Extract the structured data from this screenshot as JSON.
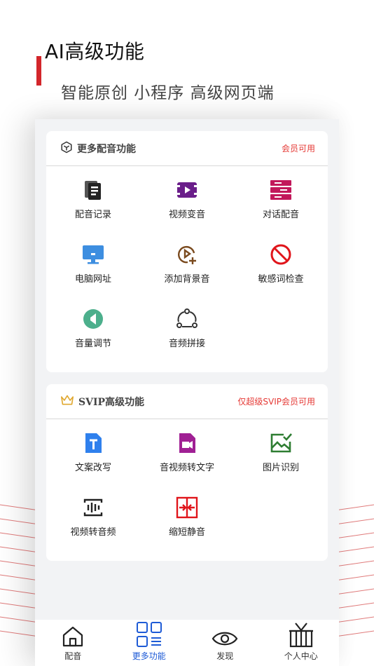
{
  "promo": {
    "title": "AI高级功能",
    "subtitle": "智能原创 小程序  高级网页端"
  },
  "card_more": {
    "title": "更多配音功能",
    "tag": "会员可用",
    "items": [
      {
        "label": "配音记录",
        "icon": "record-icon"
      },
      {
        "label": "视频变音",
        "icon": "video-voice-icon"
      },
      {
        "label": "对话配音",
        "icon": "dialogue-icon"
      },
      {
        "label": "电脑网址",
        "icon": "computer-icon"
      },
      {
        "label": "添加背景音",
        "icon": "add-bgm-icon"
      },
      {
        "label": "敏感词检查",
        "icon": "forbidden-icon"
      },
      {
        "label": "音量调节",
        "icon": "volume-icon"
      },
      {
        "label": "音频拼接",
        "icon": "splice-icon"
      }
    ]
  },
  "card_svip": {
    "title": "SVIP高级功能",
    "tag": "仅超级SVIP会员可用",
    "items": [
      {
        "label": "文案改写",
        "icon": "text-icon"
      },
      {
        "label": "音视频转文字",
        "icon": "video-to-text-icon"
      },
      {
        "label": "图片识别",
        "icon": "image-icon"
      },
      {
        "label": "视频转音频",
        "icon": "audio-wave-icon"
      },
      {
        "label": "缩短静音",
        "icon": "shorten-icon"
      }
    ]
  },
  "tabbar": {
    "items": [
      {
        "label": "配音"
      },
      {
        "label": "更多功能"
      },
      {
        "label": "发现"
      },
      {
        "label": "个人中心"
      }
    ]
  },
  "colors": {
    "accent_red": "#d3262b",
    "tag_red": "#e53935",
    "active_blue": "#1e5bd6"
  }
}
